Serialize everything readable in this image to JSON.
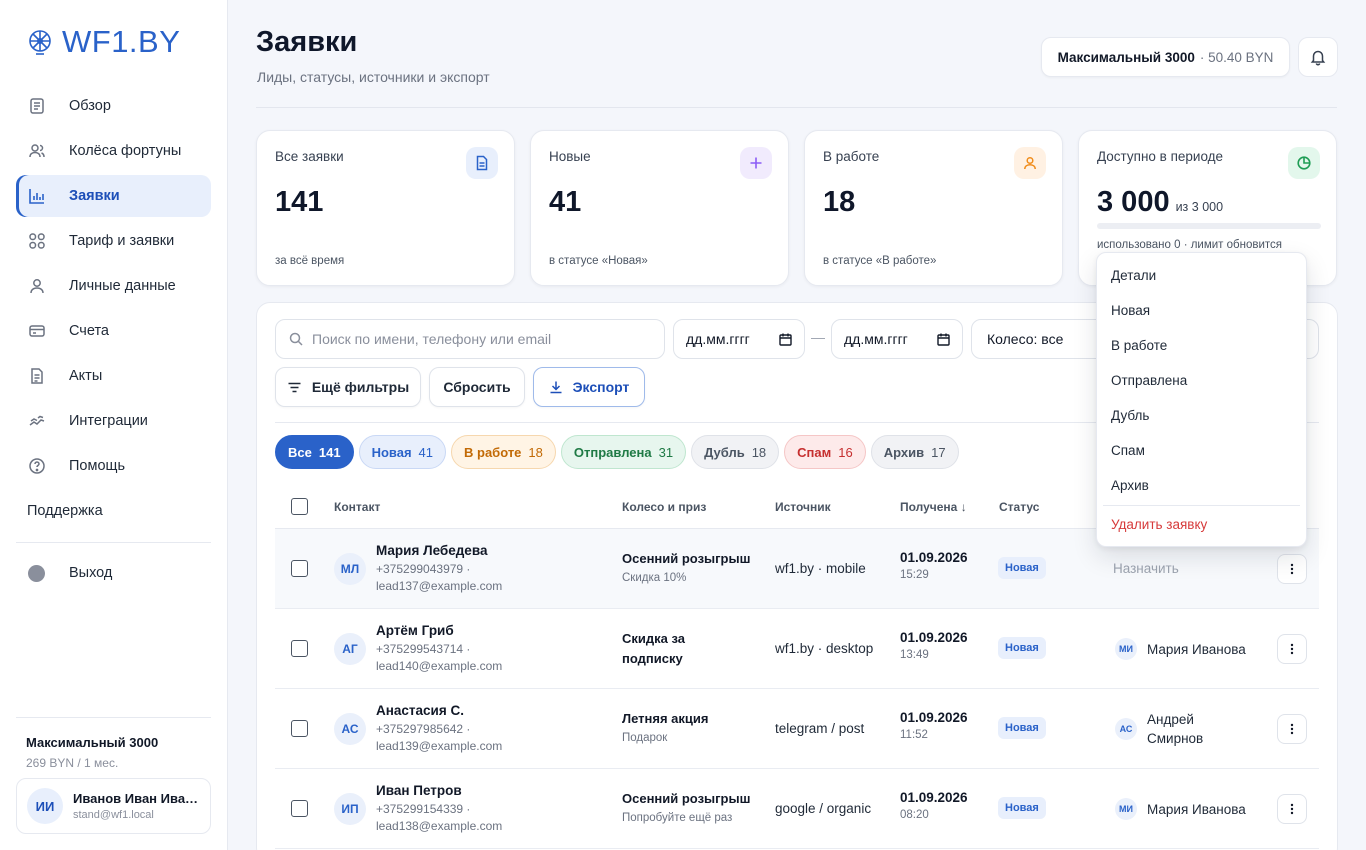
{
  "app": {
    "logo_text": "WF1.BY"
  },
  "sidebar": {
    "items": [
      {
        "label": "Обзор",
        "icon": "document-icon"
      },
      {
        "label": "Колёса фортуны",
        "icon": "users-icon"
      },
      {
        "label": "Заявки",
        "icon": "bar-chart-icon",
        "active": true
      },
      {
        "label": "Тариф и заявки",
        "icon": "grid-icon"
      },
      {
        "label": "Личные данные",
        "icon": "user-icon"
      },
      {
        "label": "Счета",
        "icon": "card-icon"
      },
      {
        "label": "Акты",
        "icon": "file-icon"
      },
      {
        "label": "Интеграции",
        "icon": "link-icon"
      },
      {
        "label": "Помощь",
        "icon": "help-icon"
      }
    ],
    "support_label": "Поддержка",
    "logout_label": "Выход",
    "plan": {
      "title": "Максимальный 3000",
      "price": "269 BYN / 1 мес."
    },
    "user": {
      "initials": "ИИ",
      "name": "Иванов Иван Иванович",
      "email": "stand@wf1.local"
    }
  },
  "header": {
    "title": "Заявки",
    "subtitle": "Лиды, статусы, источники и экспорт",
    "plan_name": "Максимальный 3000",
    "plan_balance": "· 50.40 BYN"
  },
  "stats": [
    {
      "label": "Все заявки",
      "value": "141",
      "note": "за всё время",
      "icon": "document-icon",
      "icon_bg": "#e8effc",
      "icon_color": "#2a62c9"
    },
    {
      "label": "Новые",
      "value": "41",
      "note": "в статусе «Новая»",
      "icon": "plus-icon",
      "icon_bg": "#f1ebfd",
      "icon_color": "#8b5cf6"
    },
    {
      "label": "В работе",
      "value": "18",
      "note": "в статусе «В работе»",
      "icon": "user-icon",
      "icon_bg": "#fff1e3",
      "icon_color": "#f08c1a"
    },
    {
      "label": "Доступно в периоде",
      "value": "3 000",
      "value_suffix": "из 3 000",
      "note": "использовано 0 · лимит обновится",
      "used_fraction": 0,
      "icon": "pie-icon",
      "icon_bg": "#e3f7ec",
      "icon_color": "#1f9d55"
    }
  ],
  "filters": {
    "search_placeholder": "Поиск по имени, телефону или email",
    "date_from": "дд.мм.гггг",
    "date_to": "дд.мм.гггг",
    "date_separator": "—",
    "wheel_select": "Колесо: все",
    "more_filters": "Ещё фильтры",
    "reset": "Сбросить",
    "export": "Экспорт"
  },
  "chips": [
    {
      "label": "Все",
      "count": "141",
      "bg": "#2a62c9",
      "color": "#ffffff",
      "border": "#2a62c9"
    },
    {
      "label": "Новая",
      "count": "41",
      "bg": "#e8effc",
      "color": "#2a62c9",
      "border": "#c9d8f5"
    },
    {
      "label": "В работе",
      "count": "18",
      "bg": "#fff4e5",
      "color": "#c26a06",
      "border": "#f6d7ae"
    },
    {
      "label": "Отправлена",
      "count": "31",
      "bg": "#e7f6ee",
      "color": "#1f7a45",
      "border": "#bfe6cf"
    },
    {
      "label": "Дубль",
      "count": "18",
      "bg": "#f1f2f5",
      "color": "#4b5563",
      "border": "#dfe2e8"
    },
    {
      "label": "Спам",
      "count": "16",
      "bg": "#fdeaea",
      "color": "#c62f2f",
      "border": "#f5c6c6"
    },
    {
      "label": "Архив",
      "count": "17",
      "bg": "#f1f2f5",
      "color": "#4b5563",
      "border": "#dfe2e8"
    }
  ],
  "table": {
    "headers": {
      "contact": "Контакт",
      "prize": "Колесо и приз",
      "source": "Источник",
      "received": "Получена ↓",
      "status": "Статус"
    },
    "rows": [
      {
        "initials": "МЛ",
        "name": "Мария Лебедева",
        "phone": "+375299043979 ·",
        "email": "lead137@example.com",
        "prize_title": "Осенний розыгрыш",
        "prize_sub": "Скидка 10%",
        "source": "wf1.by · mobile",
        "date": "01.09.2026",
        "time": "15:29",
        "status": "Новая",
        "assignee": "",
        "assign_label": "Назначить"
      },
      {
        "initials": "АГ",
        "name": "Артём Гриб",
        "phone": "+375299543714 ·",
        "email": "lead140@example.com",
        "prize_title": "Скидка за подписку",
        "prize_sub": "",
        "source": "wf1.by · desktop",
        "date": "01.09.2026",
        "time": "13:49",
        "status": "Новая",
        "assignee_initials": "МИ",
        "assignee": "Мария Иванова"
      },
      {
        "initials": "АС",
        "name": "Анастасия С.",
        "phone": "+375297985642 ·",
        "email": "lead139@example.com",
        "prize_title": "Летняя акция",
        "prize_sub": "Подарок",
        "source": "telegram / post",
        "date": "01.09.2026",
        "time": "11:52",
        "status": "Новая",
        "assignee_initials": "АС",
        "assignee": "Андрей Смирнов"
      },
      {
        "initials": "ИП",
        "name": "Иван Петров",
        "phone": "+375299154339 ·",
        "email": "lead138@example.com",
        "prize_title": "Осенний розыгрыш",
        "prize_sub": "Попробуйте ещё раз",
        "source": "google / organic",
        "date": "01.09.2026",
        "time": "08:20",
        "status": "Новая",
        "assignee_initials": "МИ",
        "assignee": "Мария Иванова"
      }
    ]
  },
  "dropdown": {
    "items": [
      "Детали",
      "Новая",
      "В работе",
      "Отправлена",
      "Дубль",
      "Спам",
      "Архив"
    ],
    "danger_item": "Удалить заявку"
  }
}
